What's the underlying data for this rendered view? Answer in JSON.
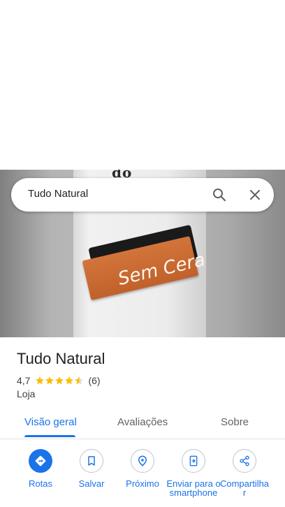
{
  "search": {
    "query": "Tudo Natural"
  },
  "hero": {
    "top_text": "do",
    "label_text": "Sem Cera"
  },
  "place": {
    "name": "Tudo Natural",
    "rating": "4,7",
    "stars": 4.7,
    "reviews": "(6)",
    "category": "Loja"
  },
  "tabs": [
    {
      "label": "Visão geral",
      "active": true
    },
    {
      "label": "Avaliações",
      "active": false
    },
    {
      "label": "Sobre",
      "active": false
    }
  ],
  "actions": [
    {
      "label": "Rotas",
      "icon": "directions-icon"
    },
    {
      "label": "Salvar",
      "icon": "bookmark-icon"
    },
    {
      "label": "Próximo",
      "icon": "nearby-icon"
    },
    {
      "label": "Enviar para o smartphone",
      "icon": "send-to-phone-icon"
    },
    {
      "label": "Compartilhar",
      "icon": "share-icon"
    }
  ],
  "colors": {
    "accent": "#1a73e8",
    "star": "#fbbc04",
    "text": "#202124"
  }
}
